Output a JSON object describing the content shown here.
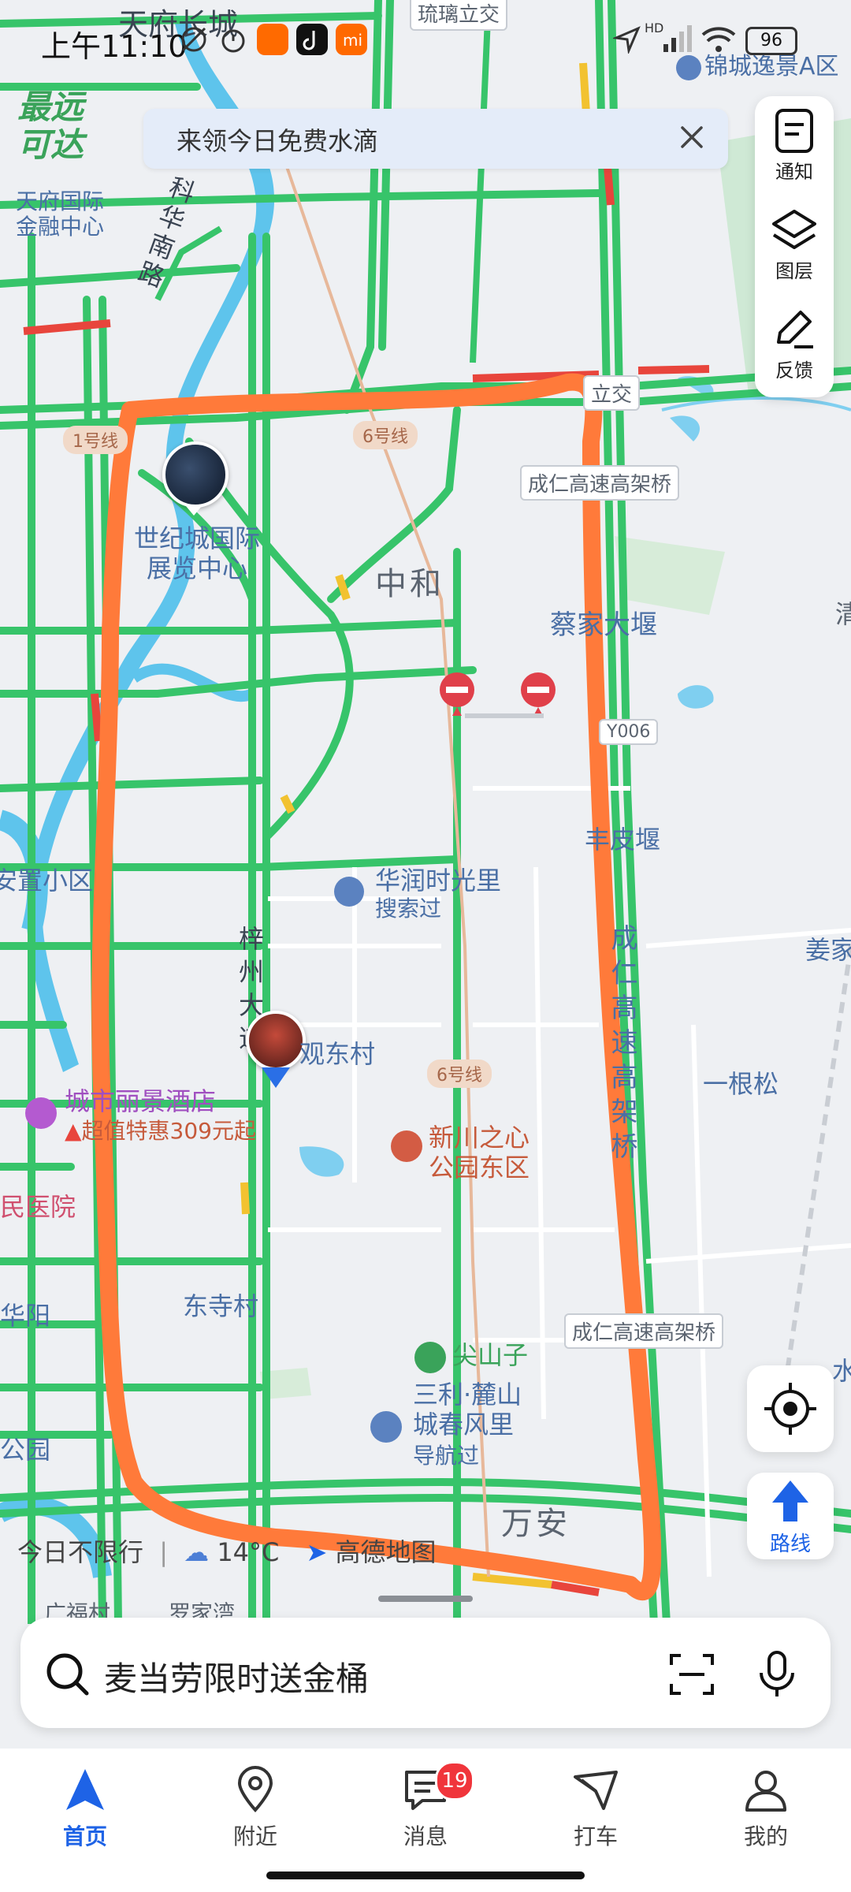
{
  "status_bar": {
    "time": "上午11:10",
    "battery": "96",
    "network": "HD"
  },
  "banner": {
    "text": "来领今日免费水滴"
  },
  "map_tools": [
    {
      "icon": "notice-icon",
      "label": "通知"
    },
    {
      "icon": "layers-icon",
      "label": "图层"
    },
    {
      "icon": "feedback-icon",
      "label": "反馈"
    }
  ],
  "map_labels": {
    "tianfu_changcheng": "天府长城",
    "liuli_lijiao": "琉璃立交",
    "jincheng_yijing": "锦城逸景A区",
    "zuiyuan_keda": "最远可达",
    "tianfu_guoji": "天府国际金融中心",
    "kehua_nanlu": "科华南路",
    "lijiao_right": "立交",
    "metro_line1": "1号线",
    "metro_line6_top": "6号线",
    "chengren_bridge_top": "成仁高速高架桥",
    "shijicheng": "世纪城国际展览中心",
    "zhonghe": "中和",
    "caijia_dayan": "蔡家大堰",
    "road_y006": "Y006",
    "qing_right": "清",
    "fengpi_yan": "丰皮堰",
    "anju": "安置小区",
    "huarun": "华润时光里",
    "huarun_sub": "搜索过",
    "chengren_vertical": "成仁高速高架桥",
    "jiang_right": "姜家",
    "zizhou_avenue": "梓州大道",
    "guandong_cun": "观东村",
    "metro_line6_mid": "6号线",
    "yigensong": "一根松",
    "hotel_name": "城市丽景酒店",
    "hotel_promo": "超值特惠309元起",
    "xinchuan": "新川之心公园东区",
    "hospital": "民医院",
    "huayang": "华阳",
    "dongsi_cun": "东寺村",
    "chengren_bridge_bottom": "成仁高速高架桥",
    "jianshanzi": "尖山子",
    "sanli": "三利·麓山城春风里",
    "sanli_sub": "导航过",
    "shui_right": "水",
    "gongyuan": "公园",
    "wan_an": "万安",
    "guangfu": "广福村",
    "lijiawan": "罗家湾"
  },
  "weather_strip": {
    "restriction": "今日不限行",
    "temperature": "14°C",
    "brand": "高德地图"
  },
  "fabs": {
    "locate_icon": "locate-icon",
    "route_label": "路线"
  },
  "search": {
    "placeholder": "麦当劳限时送金桶"
  },
  "tabs": [
    {
      "label": "首页",
      "icon": "home-arrow-icon",
      "active": true
    },
    {
      "label": "附近",
      "icon": "nearby-pin-icon"
    },
    {
      "label": "消息",
      "icon": "message-icon",
      "badge": "19"
    },
    {
      "label": "打车",
      "icon": "taxi-icon"
    },
    {
      "label": "我的",
      "icon": "profile-icon"
    }
  ],
  "colors": {
    "road_green": "#37c46a",
    "road_yellow": "#f2c230",
    "road_red": "#e8453c",
    "highlight_orange": "#ff7a3a",
    "water_blue": "#5ec4ec",
    "accent_blue": "#1e63e6"
  }
}
